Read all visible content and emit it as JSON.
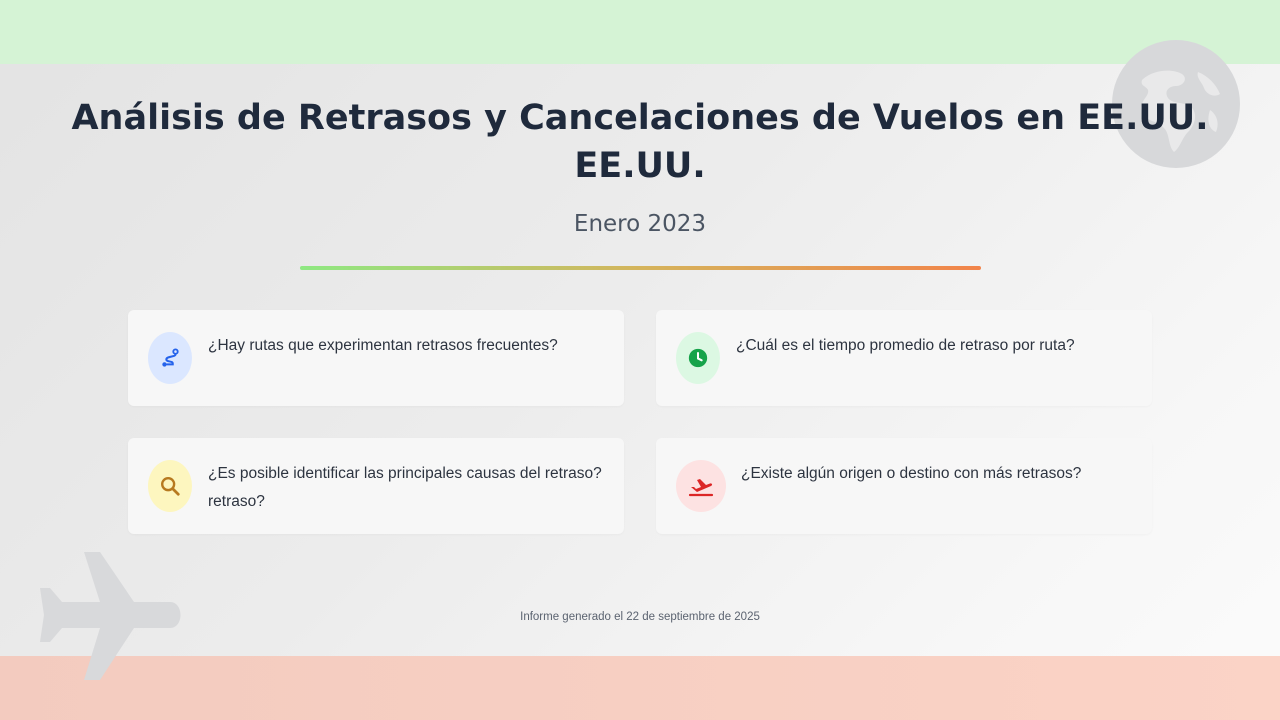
{
  "header": {
    "title": "Análisis de Retrasos y Cancelaciones de Vuelos en EE.UU. EE.UU.",
    "subtitle": "Enero 2023"
  },
  "cards": [
    {
      "question": "¿Hay rutas que experimentan retrasos frecuentes?",
      "icon": "route-icon",
      "icon_color": "#2563eb",
      "icon_bg": "#dbe7ff"
    },
    {
      "question": "¿Cuál es el tiempo promedio de retraso por ruta?",
      "icon": "clock-icon",
      "icon_color": "#16a34a",
      "icon_bg": "#dcf8e3"
    },
    {
      "question": "¿Es posible identificar las principales causas del retraso? retraso?",
      "icon": "search-icon",
      "icon_color": "#b7791f",
      "icon_bg": "#fdf6bf"
    },
    {
      "question": "¿Existe algún origen o destino con más retrasos?",
      "icon": "plane-departure-icon",
      "icon_color": "#dc2626",
      "icon_bg": "#fde2e2"
    }
  ],
  "footer": {
    "text": "Informe generado el 22 de septiembre de 2025"
  },
  "decorations": {
    "globe_icon": "globe-icon",
    "plane_icon": "plane-icon",
    "top_band_color": "#d5f3d5",
    "bottom_band_color": "#fbd3c6",
    "divider_gradient": [
      "#8ee882",
      "#d5b45c",
      "#f2844a"
    ]
  }
}
